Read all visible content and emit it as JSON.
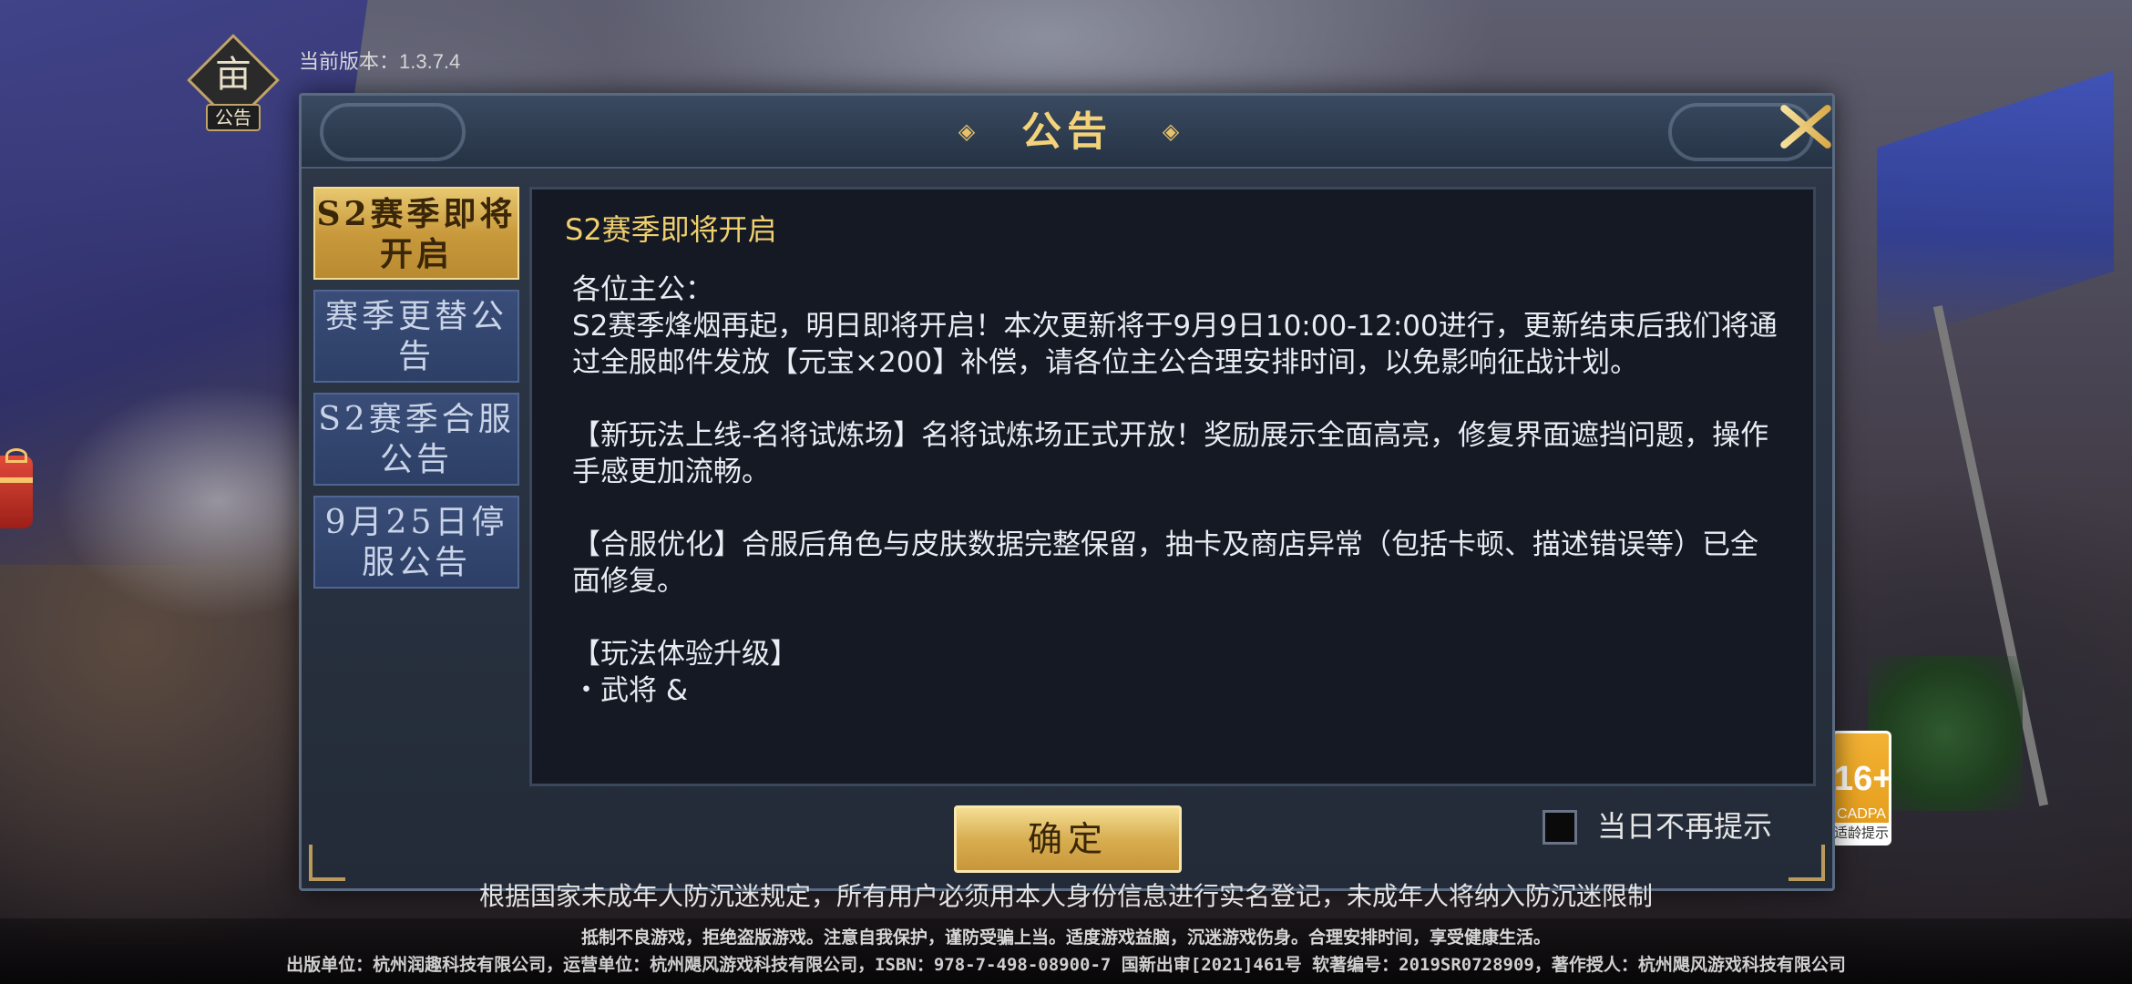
{
  "header": {
    "version_text": "当前版本：1.3.7.4",
    "notice_icon_label": "公告",
    "notice_icon_glyph": "亩"
  },
  "dialog": {
    "title": "公告",
    "ornament_left": "◈",
    "ornament_right": "◈",
    "tabs": [
      {
        "label": "S2赛季即将开启",
        "active": true
      },
      {
        "label": "赛季更替公告",
        "active": false
      },
      {
        "label": "S2赛季合服公告",
        "active": false
      },
      {
        "label": "9月25日停服公告",
        "active": false
      }
    ],
    "content": {
      "title": "S2赛季即将开启",
      "body": "各位主公：\nS2赛季烽烟再起，明日即将开启！本次更新将于9月9日10:00-12:00进行，更新结束后我们将通过全服邮件发放【元宝×200】补偿，请各位主公合理安排时间，以免影响征战计划。\n\n【新玩法上线-名将试炼场】名将试炼场正式开放！奖励展示全面高亮，修复界面遮挡问题，操作手感更加流畅。\n\n【合服优化】合服后角色与皮肤数据完整保留，抽卡及商店异常（包括卡顿、描述错误等）已全面修复。\n\n【玩法体验升级】\n・武将 &"
    },
    "confirm_label": "确定",
    "dont_show_today_label": "当日不再提示",
    "dont_show_today_checked": false
  },
  "badge": {
    "age": "16+",
    "org": "CADPA",
    "tip": "适龄提示"
  },
  "footer": {
    "anti_addiction": "根据国家未成年人防沉迷规定，所有用户必须用本人身份信息进行实名登记，未成年人将纳入防沉迷限制",
    "health_tip": "抵制不良游戏，拒绝盗版游戏。注意自我保护，谨防受骗上当。适度游戏益脑，沉迷游戏伤身。合理安排时间，享受健康生活。",
    "publisher_info": "出版单位：杭州润趣科技有限公司，运营单位：杭州飓风游戏科技有限公司，ISBN：978-7-498-08900-7 国新出审[2021]461号 软著编号：2019SR0728909，著作授人：杭州飓风游戏科技有限公司"
  },
  "colors": {
    "accent_gold": "#f0cf6e",
    "tab_active": "#d8ae51",
    "tab_inactive": "#394d78",
    "panel_bg": "#141924"
  }
}
